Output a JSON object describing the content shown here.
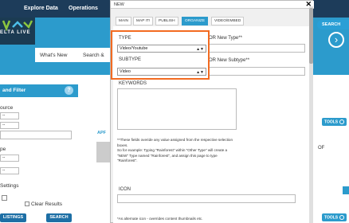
{
  "topnav": {
    "explore": "Explore Data",
    "operations": "Operations"
  },
  "header": {
    "search_pill": "SEARCH",
    "logo_text": "ELTA LIVE",
    "tabs": [
      "What's New",
      "Search &"
    ],
    "next_icon": "chevron-right-icon"
  },
  "left_panel": {
    "title": "and Filter",
    "help": "?",
    "source_label": "ource",
    "source_value": "--",
    "source_value2": "--",
    "type_label": "pe",
    "type_value": "--",
    "type_value2": "--",
    "settings_label": " Settings",
    "clear_results": "Clear Results",
    "listings_button": "LISTINGS",
    "search_button": "SEARCH"
  },
  "background_content": {
    "apf": "APF",
    "of": "OF",
    "tools": "TOOLS"
  },
  "modal": {
    "title": "NEW",
    "close": "✕",
    "tabs": [
      {
        "label": "MAIN"
      },
      {
        "label": "MAP IT!"
      },
      {
        "label": "PUBLISH"
      },
      {
        "label": "ORGANIZE"
      },
      {
        "label": "VIDEO/EMBED"
      }
    ],
    "type_label": "TYPE",
    "type_value": "Video/Youtube",
    "or_new_type": "OR New Type**",
    "subtype_label": "SUBTYPE",
    "subtype_value": "Video",
    "or_new_subtype": "OR New Subtype**",
    "keywords_label": "KEYWORDS",
    "help_lines": [
      "**These fields overide any value assigned from the respective selection",
      "boxes.",
      "So for example: Typing \"Rainforest\" within \"Other Type\" will create a",
      "\"NEW\" Type named \"Rainforest\", and assign this page to type",
      "\"Rainforest\"."
    ],
    "icon_label": "ICON",
    "icon_help": "*As alternate icon - overrides content thumbnails etc."
  },
  "colors": {
    "nav": "#1d3c5a",
    "accent": "#2c9bcc",
    "highlight": "#f36b21"
  }
}
